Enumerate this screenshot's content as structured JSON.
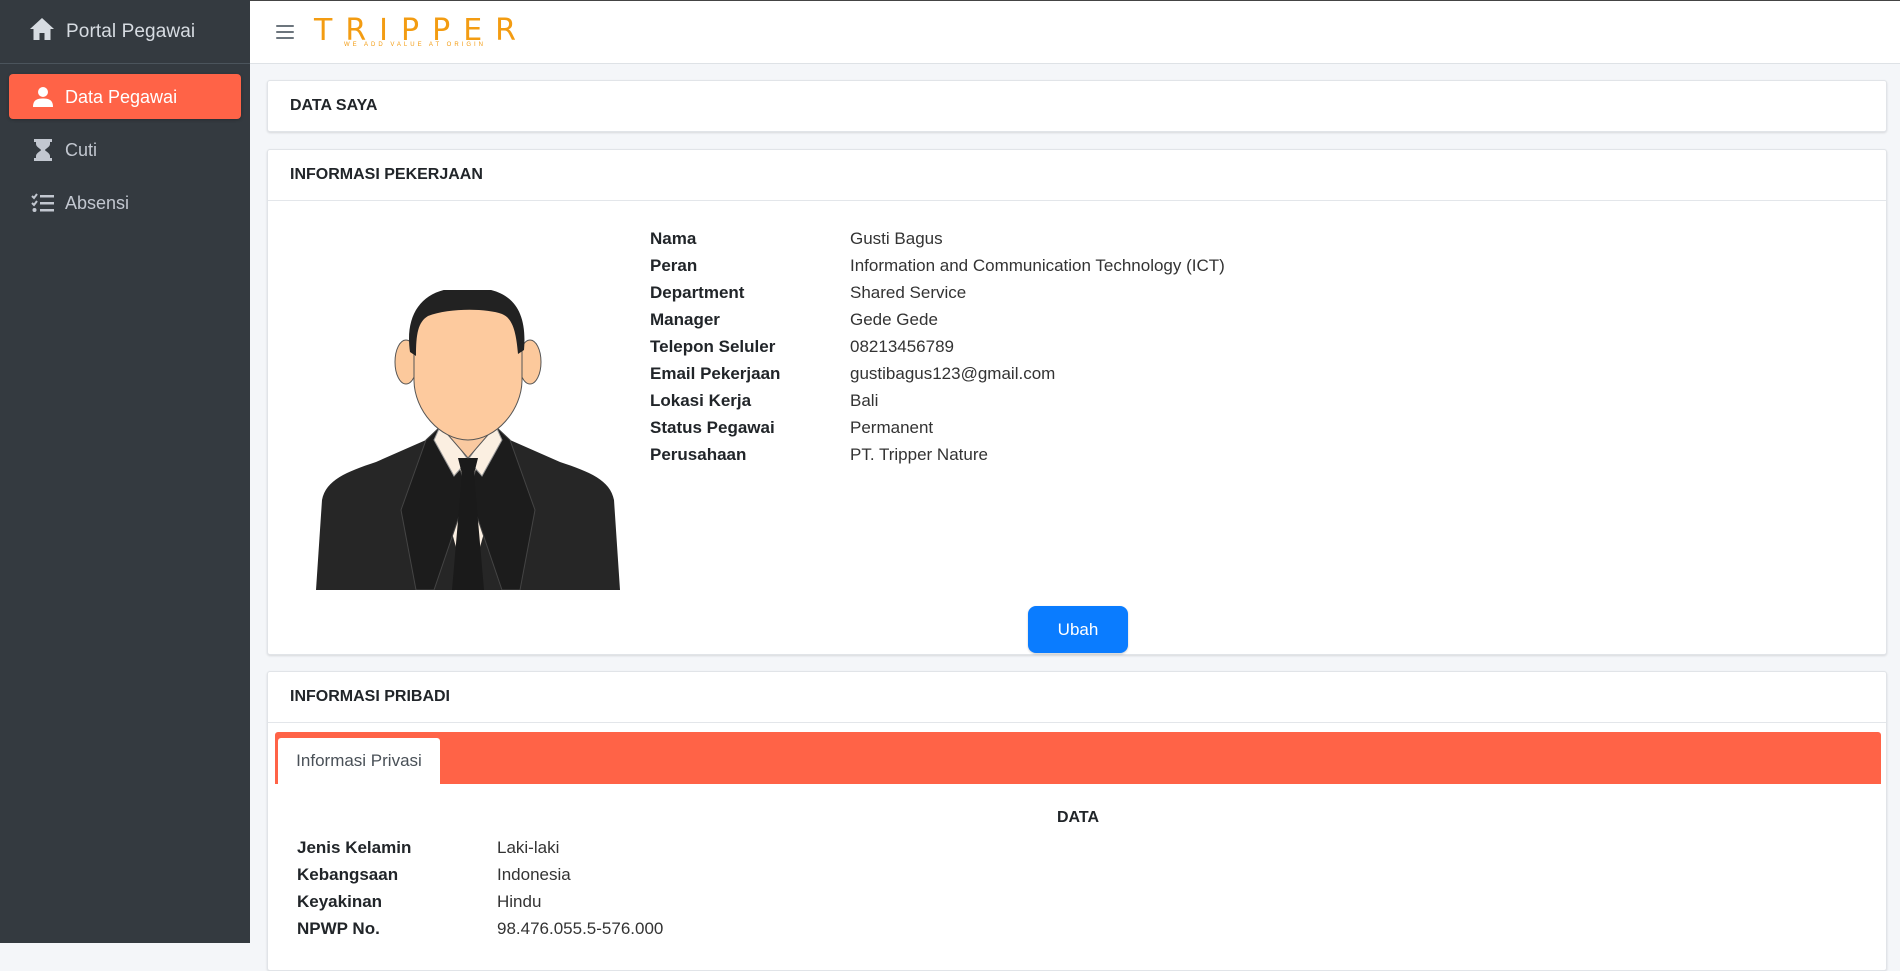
{
  "sidebar": {
    "brand": "Portal Pegawai",
    "items": [
      {
        "label": "Data Pegawai",
        "icon": "user-icon",
        "active": true
      },
      {
        "label": "Cuti",
        "icon": "hourglass-icon",
        "active": false
      },
      {
        "label": "Absensi",
        "icon": "checklist-icon",
        "active": false
      }
    ]
  },
  "topbar": {
    "logo_text": "TRIPPER",
    "logo_tagline": "WE ADD VALUE AT ORIGIN"
  },
  "cards": {
    "data_saya": {
      "title": "DATA SAYA"
    },
    "pekerjaan": {
      "title": "INFORMASI PEKERJAAN",
      "fields": [
        {
          "label": "Nama",
          "value": "Gusti Bagus"
        },
        {
          "label": "Peran",
          "value": "Information and Communication Technology (ICT)"
        },
        {
          "label": "Department",
          "value": "Shared Service"
        },
        {
          "label": "Manager",
          "value": "Gede Gede"
        },
        {
          "label": "Telepon Seluler",
          "value": "08213456789"
        },
        {
          "label": "Email Pekerjaan",
          "value": "gustibagus123@gmail.com"
        },
        {
          "label": "Lokasi Kerja",
          "value": "Bali"
        },
        {
          "label": "Status Pegawai",
          "value": "Permanent"
        },
        {
          "label": "Perusahaan",
          "value": "PT. Tripper Nature"
        }
      ],
      "button_label": "Ubah"
    },
    "pribadi": {
      "title": "INFORMASI PRIBADI",
      "tab_label": "Informasi Privasi",
      "section_title": "DATA",
      "fields": [
        {
          "label": "Jenis Kelamin",
          "value": "Laki-laki"
        },
        {
          "label": "Kebangsaan",
          "value": "Indonesia"
        },
        {
          "label": "Keyakinan",
          "value": "Hindu"
        },
        {
          "label": "NPWP No.",
          "value": "98.476.055.5-576.000"
        }
      ]
    }
  },
  "colors": {
    "sidebar_bg": "#343a40",
    "accent": "#ff6347",
    "primary_button": "#0a7cff",
    "logo": "#f39c12"
  }
}
